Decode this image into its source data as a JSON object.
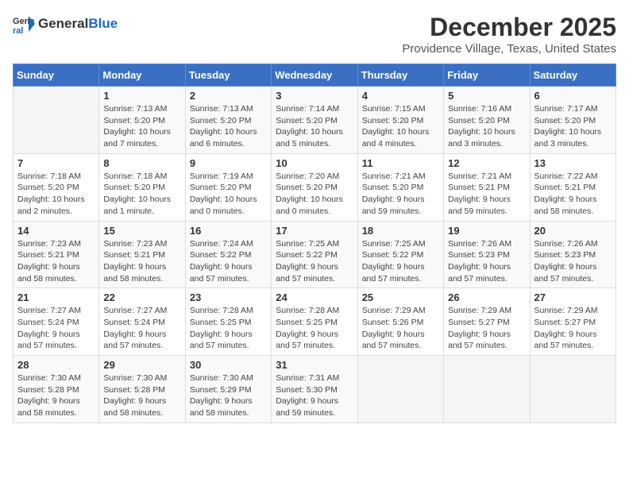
{
  "logo": {
    "general": "General",
    "blue": "Blue"
  },
  "title": {
    "month": "December 2025",
    "location": "Providence Village, Texas, United States"
  },
  "headers": [
    "Sunday",
    "Monday",
    "Tuesday",
    "Wednesday",
    "Thursday",
    "Friday",
    "Saturday"
  ],
  "weeks": [
    [
      {
        "day": "",
        "info": ""
      },
      {
        "day": "1",
        "info": "Sunrise: 7:13 AM\nSunset: 5:20 PM\nDaylight: 10 hours\nand 7 minutes."
      },
      {
        "day": "2",
        "info": "Sunrise: 7:13 AM\nSunset: 5:20 PM\nDaylight: 10 hours\nand 6 minutes."
      },
      {
        "day": "3",
        "info": "Sunrise: 7:14 AM\nSunset: 5:20 PM\nDaylight: 10 hours\nand 5 minutes."
      },
      {
        "day": "4",
        "info": "Sunrise: 7:15 AM\nSunset: 5:20 PM\nDaylight: 10 hours\nand 4 minutes."
      },
      {
        "day": "5",
        "info": "Sunrise: 7:16 AM\nSunset: 5:20 PM\nDaylight: 10 hours\nand 3 minutes."
      },
      {
        "day": "6",
        "info": "Sunrise: 7:17 AM\nSunset: 5:20 PM\nDaylight: 10 hours\nand 3 minutes."
      }
    ],
    [
      {
        "day": "7",
        "info": "Sunrise: 7:18 AM\nSunset: 5:20 PM\nDaylight: 10 hours\nand 2 minutes."
      },
      {
        "day": "8",
        "info": "Sunrise: 7:18 AM\nSunset: 5:20 PM\nDaylight: 10 hours\nand 1 minute."
      },
      {
        "day": "9",
        "info": "Sunrise: 7:19 AM\nSunset: 5:20 PM\nDaylight: 10 hours\nand 0 minutes."
      },
      {
        "day": "10",
        "info": "Sunrise: 7:20 AM\nSunset: 5:20 PM\nDaylight: 10 hours\nand 0 minutes."
      },
      {
        "day": "11",
        "info": "Sunrise: 7:21 AM\nSunset: 5:20 PM\nDaylight: 9 hours\nand 59 minutes."
      },
      {
        "day": "12",
        "info": "Sunrise: 7:21 AM\nSunset: 5:21 PM\nDaylight: 9 hours\nand 59 minutes."
      },
      {
        "day": "13",
        "info": "Sunrise: 7:22 AM\nSunset: 5:21 PM\nDaylight: 9 hours\nand 58 minutes."
      }
    ],
    [
      {
        "day": "14",
        "info": "Sunrise: 7:23 AM\nSunset: 5:21 PM\nDaylight: 9 hours\nand 58 minutes."
      },
      {
        "day": "15",
        "info": "Sunrise: 7:23 AM\nSunset: 5:21 PM\nDaylight: 9 hours\nand 58 minutes."
      },
      {
        "day": "16",
        "info": "Sunrise: 7:24 AM\nSunset: 5:22 PM\nDaylight: 9 hours\nand 57 minutes."
      },
      {
        "day": "17",
        "info": "Sunrise: 7:25 AM\nSunset: 5:22 PM\nDaylight: 9 hours\nand 57 minutes."
      },
      {
        "day": "18",
        "info": "Sunrise: 7:25 AM\nSunset: 5:22 PM\nDaylight: 9 hours\nand 57 minutes."
      },
      {
        "day": "19",
        "info": "Sunrise: 7:26 AM\nSunset: 5:23 PM\nDaylight: 9 hours\nand 57 minutes."
      },
      {
        "day": "20",
        "info": "Sunrise: 7:26 AM\nSunset: 5:23 PM\nDaylight: 9 hours\nand 57 minutes."
      }
    ],
    [
      {
        "day": "21",
        "info": "Sunrise: 7:27 AM\nSunset: 5:24 PM\nDaylight: 9 hours\nand 57 minutes."
      },
      {
        "day": "22",
        "info": "Sunrise: 7:27 AM\nSunset: 5:24 PM\nDaylight: 9 hours\nand 57 minutes."
      },
      {
        "day": "23",
        "info": "Sunrise: 7:28 AM\nSunset: 5:25 PM\nDaylight: 9 hours\nand 57 minutes."
      },
      {
        "day": "24",
        "info": "Sunrise: 7:28 AM\nSunset: 5:25 PM\nDaylight: 9 hours\nand 57 minutes."
      },
      {
        "day": "25",
        "info": "Sunrise: 7:29 AM\nSunset: 5:26 PM\nDaylight: 9 hours\nand 57 minutes."
      },
      {
        "day": "26",
        "info": "Sunrise: 7:29 AM\nSunset: 5:27 PM\nDaylight: 9 hours\nand 57 minutes."
      },
      {
        "day": "27",
        "info": "Sunrise: 7:29 AM\nSunset: 5:27 PM\nDaylight: 9 hours\nand 57 minutes."
      }
    ],
    [
      {
        "day": "28",
        "info": "Sunrise: 7:30 AM\nSunset: 5:28 PM\nDaylight: 9 hours\nand 58 minutes."
      },
      {
        "day": "29",
        "info": "Sunrise: 7:30 AM\nSunset: 5:28 PM\nDaylight: 9 hours\nand 58 minutes."
      },
      {
        "day": "30",
        "info": "Sunrise: 7:30 AM\nSunset: 5:29 PM\nDaylight: 9 hours\nand 58 minutes."
      },
      {
        "day": "31",
        "info": "Sunrise: 7:31 AM\nSunset: 5:30 PM\nDaylight: 9 hours\nand 59 minutes."
      },
      {
        "day": "",
        "info": ""
      },
      {
        "day": "",
        "info": ""
      },
      {
        "day": "",
        "info": ""
      }
    ]
  ]
}
